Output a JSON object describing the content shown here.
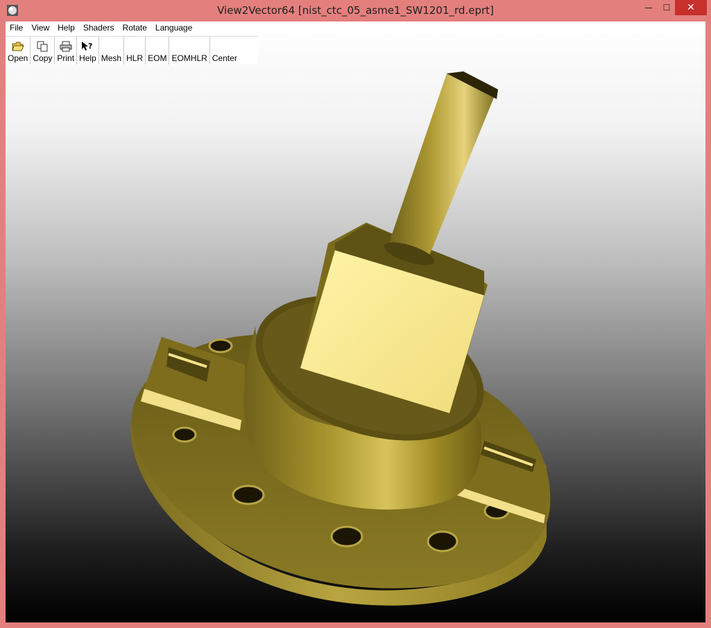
{
  "window": {
    "title": "View2Vector64 [nist_ctc_05_asme1_SW1201_rd.eprt]",
    "minimize_glyph": "—",
    "maximize_glyph": "☐",
    "close_glyph": "✕"
  },
  "menubar": {
    "items": [
      "File",
      "View",
      "Help",
      "Shaders",
      "Rotate",
      "Language"
    ]
  },
  "toolbar": {
    "buttons": [
      {
        "label": "Open",
        "icon": "open-folder-icon"
      },
      {
        "label": "Copy",
        "icon": "copy-icon"
      },
      {
        "label": "Print",
        "icon": "printer-icon"
      },
      {
        "label": "Help",
        "icon": "help-cursor-icon"
      },
      {
        "label": "Mesh",
        "icon": ""
      },
      {
        "label": "HLR",
        "icon": ""
      },
      {
        "label": "EOM",
        "icon": ""
      },
      {
        "label": "EOMHLR",
        "icon": ""
      },
      {
        "label": "Center",
        "icon": ""
      }
    ]
  },
  "colors": {
    "titlebar": "#e3807e",
    "close_button": "#c7302b",
    "model_gold": "#b8a437",
    "model_dark": "#5a4f12"
  }
}
